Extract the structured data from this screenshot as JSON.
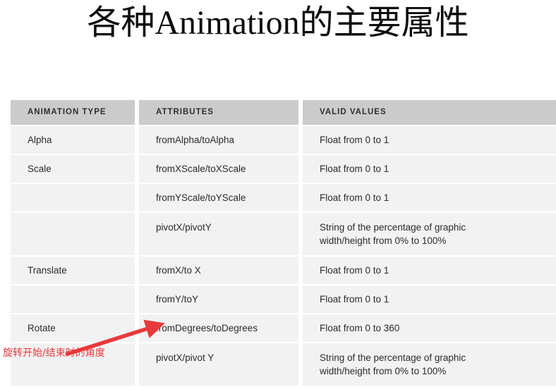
{
  "slide": {
    "title": "各种Animation的主要属性",
    "accent_color": "#e8393c",
    "header_bg": "#cbcbcb",
    "row_bg": "#f2f2f2"
  },
  "table": {
    "columns": [
      "ANIMATION TYPE",
      "ATTRIBUTES",
      "VALID VALUES"
    ],
    "rows": [
      {
        "type": "Alpha",
        "attribute": "fromAlpha/toAlpha",
        "value_line1": "Float from 0 to 1",
        "value_line2": ""
      },
      {
        "type": "Scale",
        "attribute": "fromXScale/toXScale",
        "value_line1": "Float from 0 to 1",
        "value_line2": ""
      },
      {
        "type": "",
        "attribute": "fromYScale/toYScale",
        "value_line1": "Float from 0 to 1",
        "value_line2": ""
      },
      {
        "type": "",
        "attribute": "pivotX/pivotY",
        "value_line1": "String of the percentage of graphic",
        "value_line2": "width/height from 0% to 100%"
      },
      {
        "type": "Translate",
        "attribute": "fromX/to X",
        "value_line1": "Float from 0 to 1",
        "value_line2": ""
      },
      {
        "type": "",
        "attribute": "fromY/toY",
        "value_line1": "Float from 0 to 1",
        "value_line2": ""
      },
      {
        "type": "Rotate",
        "attribute": "fromDegrees/toDegrees",
        "value_line1": "Float from 0 to 360",
        "value_line2": ""
      },
      {
        "type": "",
        "attribute": "pivotX/pivot Y",
        "value_line1": "String of the percentage of graphic",
        "value_line2": "width/height from 0% to 100%"
      }
    ]
  },
  "annotation": {
    "note": "旋转开始/结束时的角度",
    "color": "#e8393c"
  }
}
